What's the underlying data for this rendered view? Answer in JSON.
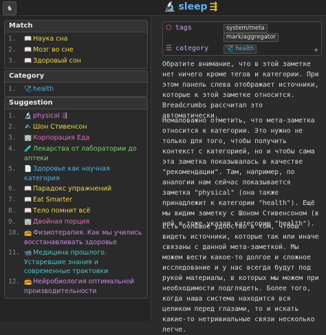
{
  "app_icon": "♞",
  "note": {
    "icon": "🔬",
    "title": "sleep",
    "mark": "⇶"
  },
  "sidebar": {
    "match": {
      "header": "Match",
      "items": [
        {
          "num": "1.",
          "icon": "📖",
          "label": "Наука сна",
          "color": "#f0d84a"
        },
        {
          "num": "2.",
          "icon": "📖",
          "label": "Мозг во сне",
          "color": "#f0d84a"
        },
        {
          "num": "3.",
          "icon": "📖",
          "label": "Здоровый сон",
          "color": "#f0d84a"
        }
      ]
    },
    "category": {
      "header": "Category",
      "items": [
        {
          "num": "1.",
          "icon": "🩺",
          "label": "health",
          "color": "#5bb0e0"
        }
      ]
    },
    "suggestion": {
      "header": "Suggestion",
      "items": [
        {
          "num": "1.",
          "icon": "🔬",
          "label": "physical ⇶",
          "color": "#d47ad8"
        },
        {
          "num": "2.",
          "icon": "✍",
          "label": "Шон Стивенсон",
          "color": "#f0d84a"
        },
        {
          "num": "3.",
          "icon": "🏢",
          "label": "Корпорация Еда",
          "color": "#e86bb6"
        },
        {
          "num": "4.",
          "icon": "🧪",
          "label": "Лекарства от лаборатории до аптеки",
          "color": "#7fcf6a"
        },
        {
          "num": "5.",
          "icon": "📄",
          "label": "Здоровье как научная категория",
          "color": "#5bb0e0"
        },
        {
          "num": "6.",
          "icon": "📖",
          "label": "Парадокс упражнений",
          "color": "#f0d84a"
        },
        {
          "num": "7.",
          "icon": "📖",
          "label": "Eat Smarter",
          "color": "#f0d84a"
        },
        {
          "num": "8.",
          "icon": "📖",
          "label": "Тело помнит всё",
          "color": "#f0d84a"
        },
        {
          "num": "9.",
          "icon": "🏢",
          "label": "Двойная порция",
          "color": "#e86bb6"
        },
        {
          "num": "10.",
          "icon": "📻",
          "label": "Физиотерапия. Как мы учились восстанавливать здоровье",
          "color": "#c98be6"
        },
        {
          "num": "11.",
          "icon": "📹",
          "label": "Медицина прошлого. Устаревшие знания и современные трактовки",
          "color": "#4fc2c2"
        },
        {
          "num": "12.",
          "icon": "📻",
          "label": "Нейробиология оптимальной производительности",
          "color": "#c98be6"
        }
      ]
    }
  },
  "meta": {
    "tags_label": "tags",
    "tags": [
      "system/meta",
      "mark/aggregator"
    ],
    "category_label": "category",
    "category_value": "health",
    "add": "+"
  },
  "body": {
    "p1": "Обратите внимание, что в этой заметке нет ничего кроме тегов и категории. При этом панель слева отображает источники, которые к этой заметке относится. Breadcrumbs рассчитал это автоматически.",
    "p2": "Немаловажно отметить, что мета-заметка относится к категории. Это нужно не только для того, чтобы получить контекст с категорией, но и чтобы сама эта заметка показывалась в качестве \"рекомендации\". Там, например, по аналогии нам сейчас показывается заметка \"physical\" (она также принадлежит к категории \"health\"). Ещё мы видим заметку с Шоном Стивенсоном (в ней я тоже указал категорию \"health\").",
    "p3": "Есть большое удобство в том, чтобы видеть источники, которые так или иначе связаны с данной мета-заметкой. Мы можем вести какое-то долгое и сложное исследование и у нас всегда будут под рукой материалы, в которых мы можем при необходимости подглядеть. Более того, когда наша система находится вся целиком перед глазами, то и искать какие-то нетривиальные связи несколько легче."
  },
  "colors": {
    "accent": "#6ab0f3",
    "tag_label": "#c7a3e8"
  }
}
